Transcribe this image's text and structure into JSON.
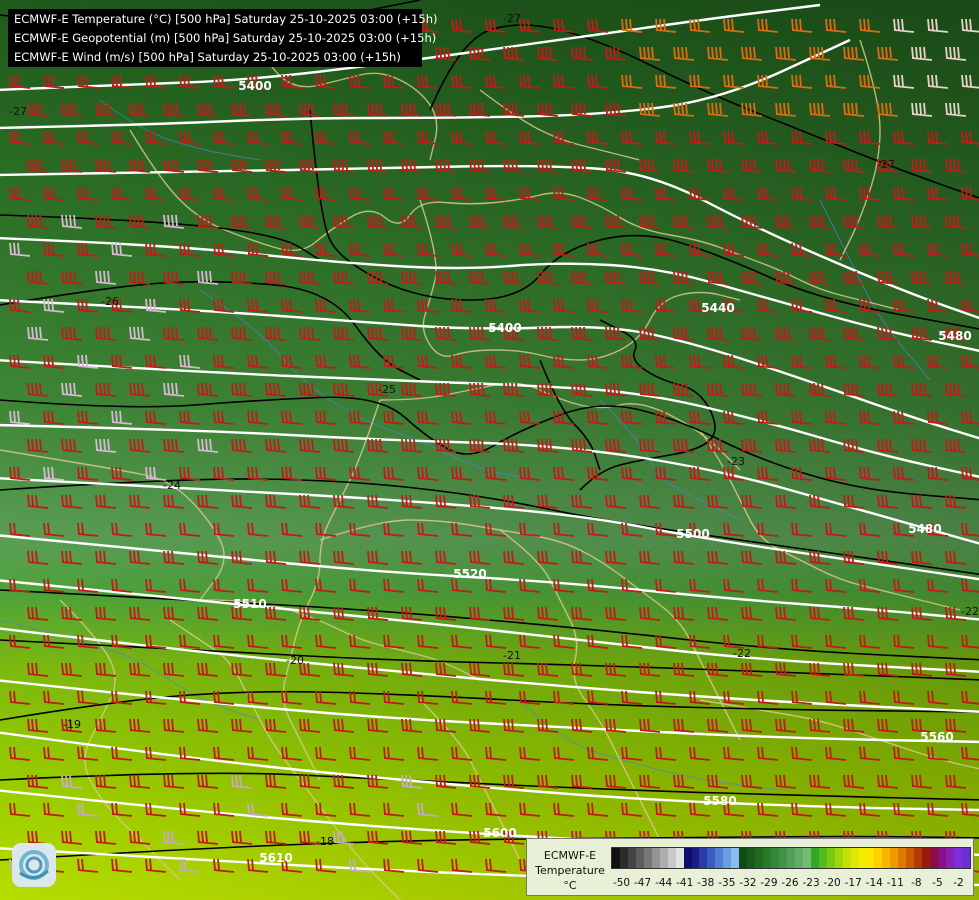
{
  "header": {
    "lines": [
      "ECMWF-E Temperature (°C) [500 hPa] Saturday 25-10-2025 03:00 (+15h)",
      "ECMWF-E Geopotential (m) [500 hPa] Saturday 25-10-2025 03:00 (+15h)",
      "ECMWF-E Wind (m/s) [500 hPa] Saturday 25-10-2025 03:00 (+15h)"
    ]
  },
  "geopotential_labels": [
    "5400",
    "5400",
    "5440",
    "5480",
    "5500",
    "5480",
    "5520",
    "5510",
    "5560",
    "5580",
    "5600",
    "5610"
  ],
  "temperature_labels": [
    "-27",
    "-27",
    "-27",
    "-26",
    "-25",
    "-24",
    "-23",
    "-22",
    "-22",
    "-21",
    "-20",
    "-19",
    "-18"
  ],
  "legend": {
    "title_line1": "ECMWF-E",
    "title_line2": "Temperature",
    "unit": "°C",
    "ticks": [
      "-50",
      "-47",
      "-44",
      "-41",
      "-38",
      "-35",
      "-32",
      "-29",
      "-26",
      "-23",
      "-20",
      "-17",
      "-14",
      "-11",
      "-8",
      "-5",
      "-2"
    ],
    "colors": [
      "#111111",
      "#2b2b2b",
      "#444444",
      "#5e5e5e",
      "#787878",
      "#939393",
      "#adadad",
      "#c8c8c8",
      "#e2e2e2",
      "#0d0d6b",
      "#1b1b8a",
      "#2a3aa6",
      "#3a5bbf",
      "#4f7ed3",
      "#6a9ee3",
      "#8abdf0",
      "#0f4a12",
      "#175a19",
      "#206a22",
      "#2a7a2c",
      "#35873a",
      "#439448",
      "#52a158",
      "#62ae68",
      "#74bb74",
      "#2fa82a",
      "#55b91f",
      "#7ac914",
      "#9fd60c",
      "#c2e005",
      "#e0e800",
      "#f3ee00",
      "#ffe500",
      "#ffd000",
      "#f8b400",
      "#ef9800",
      "#e07a00",
      "#cc5a00",
      "#b53a00",
      "#9a1a10",
      "#8c0d44",
      "#8a0f86",
      "#8a20b8",
      "#7e2fd8",
      "#6a2fd8"
    ]
  },
  "colors": {
    "cold_fill": "#2a6b26",
    "warm_fill": "#b4dc00",
    "isohypse": "#ffffff",
    "isotherm": "#000000",
    "barb": "#c41a1a",
    "border": "#d8c98a",
    "river": "#4a86c8"
  },
  "icons": [
    "wind-barb-icon",
    "logo-icon"
  ]
}
